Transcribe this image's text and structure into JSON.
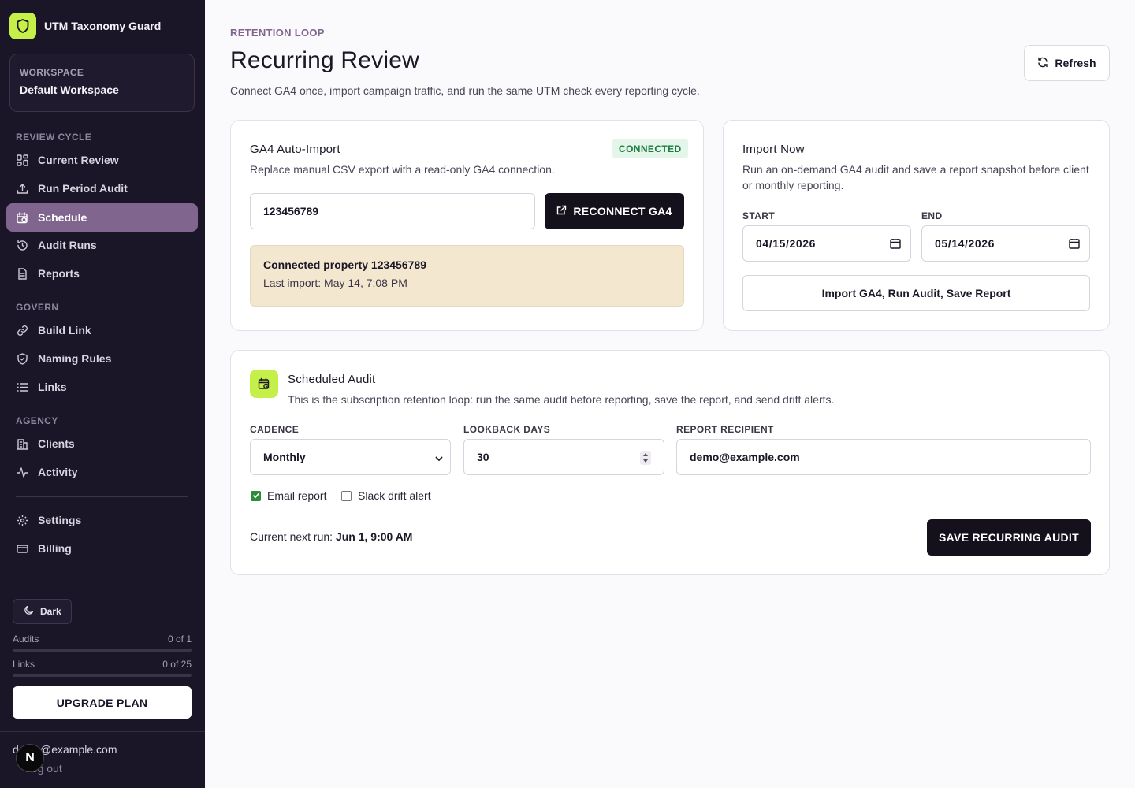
{
  "brand": {
    "name": "UTM Taxonomy Guard"
  },
  "workspace": {
    "label": "WORKSPACE",
    "name": "Default Workspace"
  },
  "nav": {
    "review_cycle_title": "REVIEW CYCLE",
    "review_cycle": [
      {
        "label": "Current Review",
        "icon": "grid-icon"
      },
      {
        "label": "Run Period Audit",
        "icon": "upload-icon"
      },
      {
        "label": "Schedule",
        "icon": "calendar-clock-icon",
        "active": true
      },
      {
        "label": "Audit Runs",
        "icon": "history-icon"
      },
      {
        "label": "Reports",
        "icon": "document-icon"
      }
    ],
    "govern_title": "GOVERN",
    "govern": [
      {
        "label": "Build Link",
        "icon": "link-icon"
      },
      {
        "label": "Naming Rules",
        "icon": "shield-icon"
      },
      {
        "label": "Links",
        "icon": "list-icon"
      }
    ],
    "agency_title": "AGENCY",
    "agency": [
      {
        "label": "Clients",
        "icon": "building-icon"
      },
      {
        "label": "Activity",
        "icon": "activity-icon"
      }
    ],
    "footer": [
      {
        "label": "Settings",
        "icon": "gear-icon"
      },
      {
        "label": "Billing",
        "icon": "card-icon"
      }
    ]
  },
  "sidebar_bottom": {
    "theme_label": "Dark",
    "audits_label": "Audits",
    "audits_value": "0 of 1",
    "audits_fraction": 0,
    "links_label": "Links",
    "links_value": "0 of 25",
    "links_fraction": 0,
    "upgrade_label": "UPGRADE PLAN",
    "user_email": "demo@example.com",
    "logout_label": "Log out",
    "n_badge": "N"
  },
  "header": {
    "eyebrow": "RETENTION LOOP",
    "title": "Recurring Review",
    "subtitle": "Connect GA4 once, import campaign traffic, and run the same UTM check every reporting cycle.",
    "refresh_label": "Refresh"
  },
  "ga4": {
    "title": "GA4 Auto-Import",
    "status": "CONNECTED",
    "desc": "Replace manual CSV export with a read-only GA4 connection.",
    "property_value": "123456789",
    "reconnect_label": "RECONNECT GA4",
    "info_title": "Connected property 123456789",
    "info_last_import": "Last import: May 14, 7:08 PM"
  },
  "import_now": {
    "title": "Import Now",
    "desc": "Run an on-demand GA4 audit and save a report snapshot before client or monthly reporting.",
    "start_label": "START",
    "start_value": "04/15/2026",
    "end_label": "END",
    "end_value": "05/14/2026",
    "action_label": "Import GA4, Run Audit, Save Report"
  },
  "scheduled": {
    "title": "Scheduled Audit",
    "desc": "This is the subscription retention loop: run the same audit before reporting, save the report, and send drift alerts.",
    "cadence_label": "CADENCE",
    "cadence_value": "Monthly",
    "lookback_label": "LOOKBACK DAYS",
    "lookback_value": "30",
    "recipient_label": "REPORT RECIPIENT",
    "recipient_value": "demo@example.com",
    "email_report_label": "Email report",
    "email_report_checked": true,
    "slack_label": "Slack drift alert",
    "slack_checked": false,
    "next_run_prefix": "Current next run:",
    "next_run_value": "Jun 1, 9:00 AM",
    "save_label": "SAVE RECURRING AUDIT"
  },
  "colors": {
    "accent": "#c5f04a",
    "sidebar": "#1a1527",
    "active_nav": "#80658f",
    "eyebrow": "#80658f"
  }
}
